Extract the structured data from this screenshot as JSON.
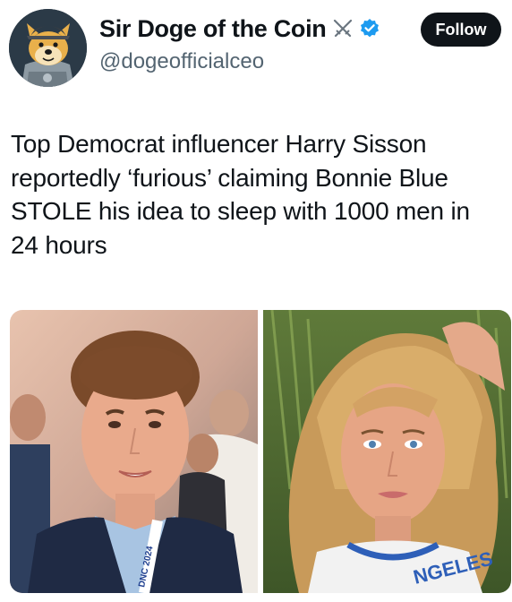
{
  "author": {
    "display_name": "Sir Doge of the Coin",
    "handle": "@dogeofficialceo",
    "avatar_icon": "doge-knight-avatar",
    "badges": [
      "crossed-swords-icon",
      "verified-badge-icon"
    ],
    "verified_color": "#1d9bf0"
  },
  "actions": {
    "follow_label": "Follow"
  },
  "post": {
    "text": "Top Democrat influencer Harry Sisson reportedly ‘furious’ claiming Bonnie Blue STOLE his idea to sleep with 1000 men in 24 hours"
  },
  "media": {
    "left_photo": {
      "lanyard_text": "DNC 2024"
    },
    "right_photo": {
      "shirt_text": "NGELES"
    }
  }
}
